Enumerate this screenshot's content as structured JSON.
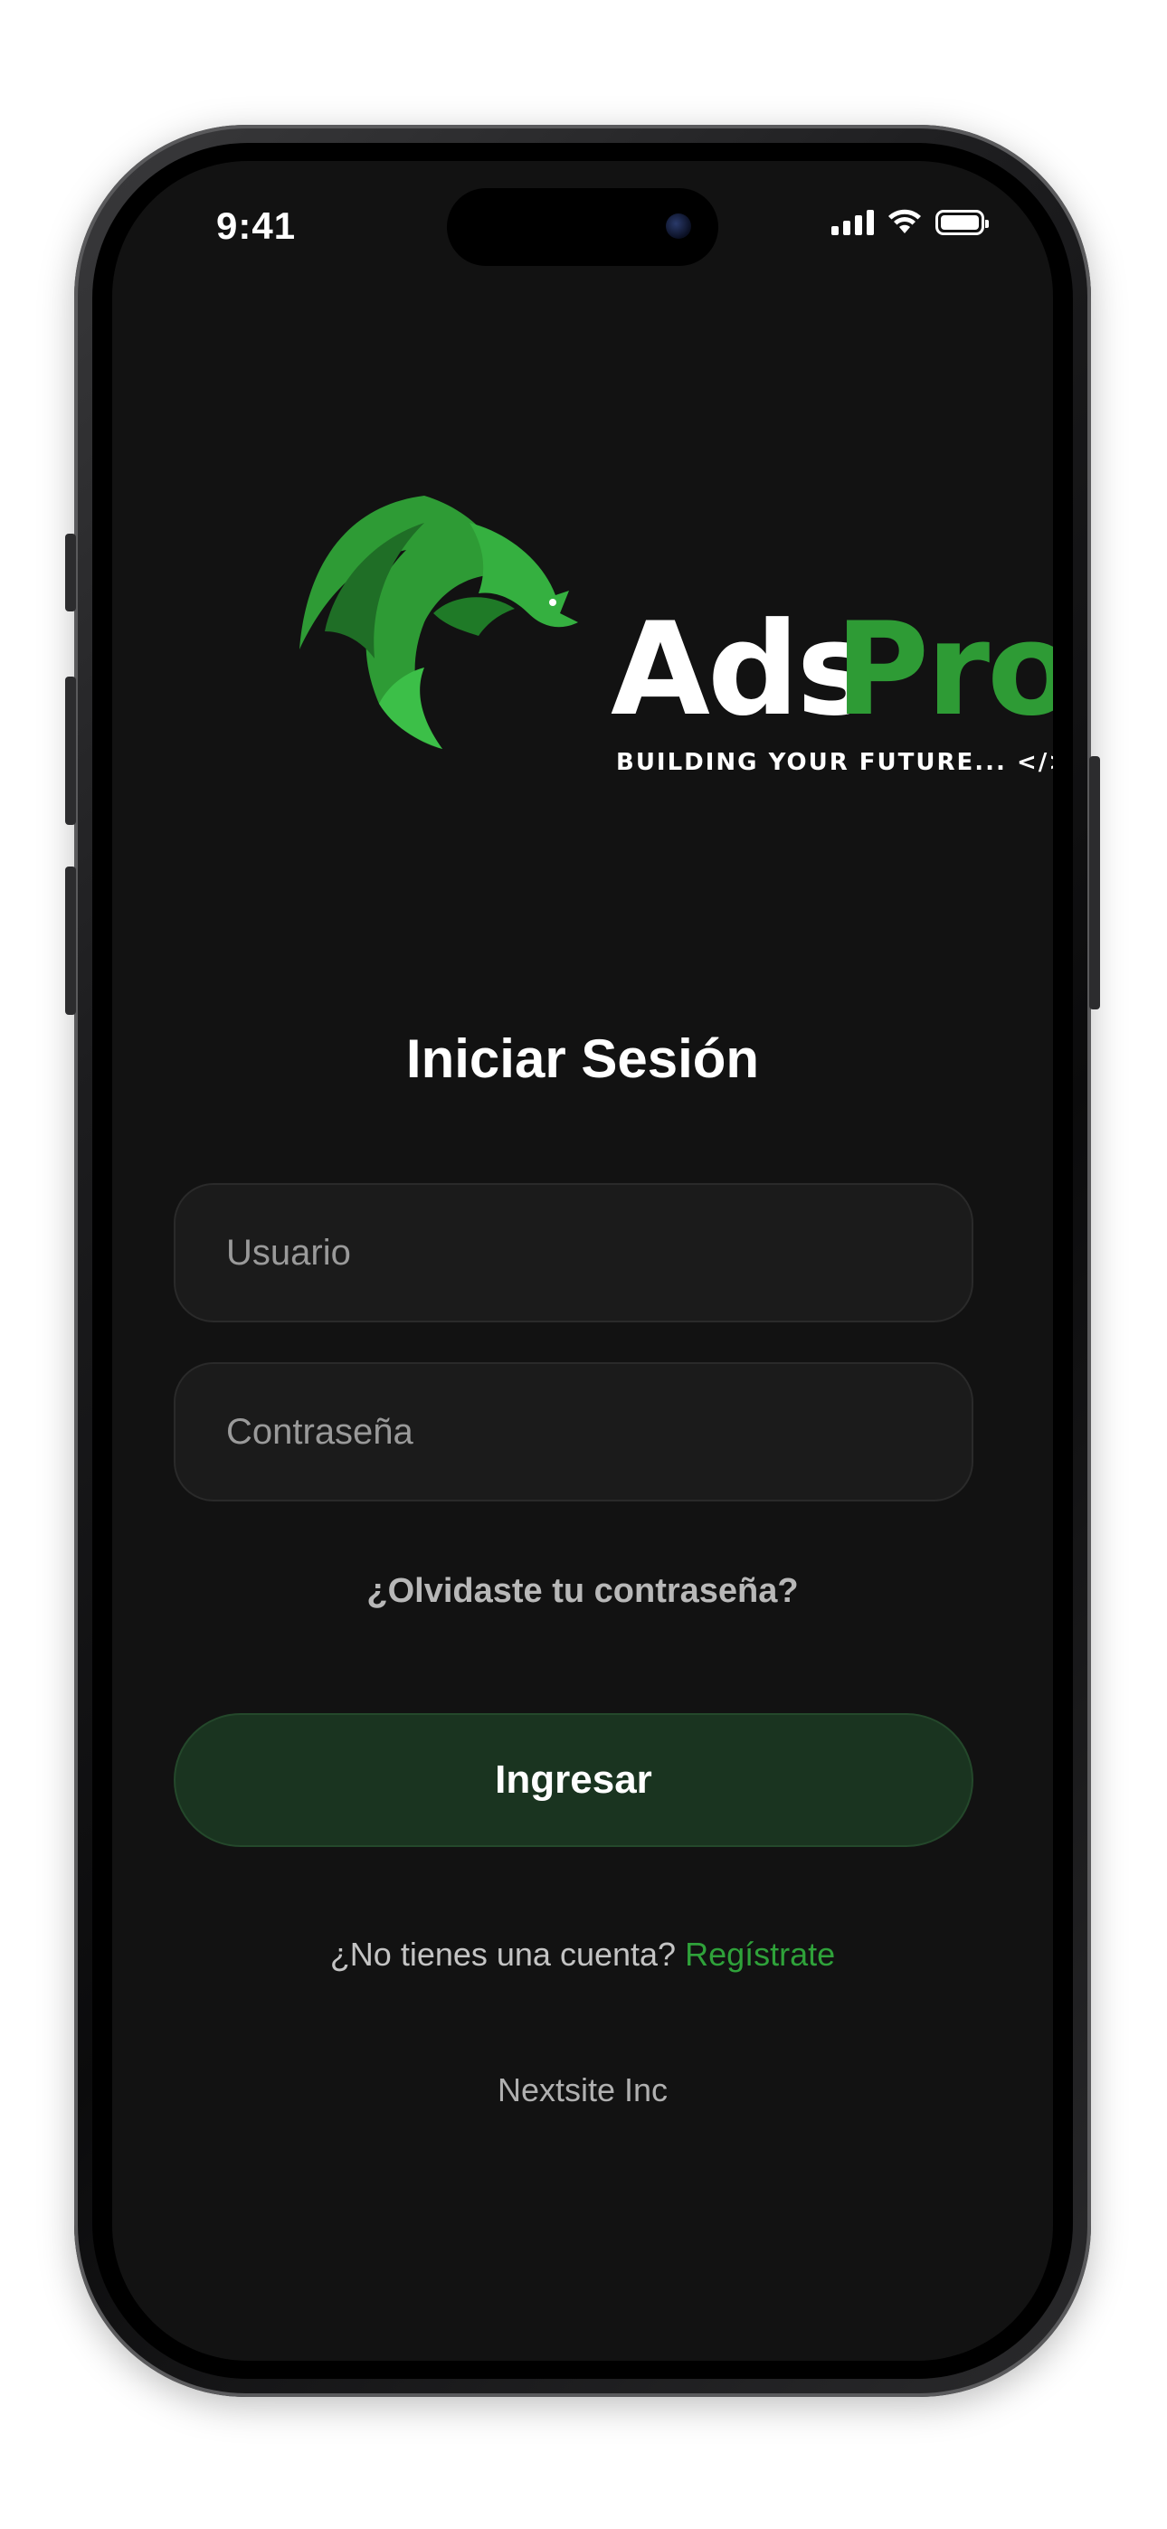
{
  "status_bar": {
    "time": "9:41"
  },
  "logo": {
    "word_part1": "Ads",
    "word_part2": "Pro",
    "tagline": "BUILDING YOUR FUTURE... </>",
    "colors": {
      "white": "#ffffff",
      "green": "#2e9b35"
    }
  },
  "login": {
    "title": "Iniciar Sesión",
    "username_placeholder": "Usuario",
    "password_placeholder": "Contraseña",
    "forgot_label": "¿Olvidaste tu contraseña?",
    "submit_label": "Ingresar",
    "register_prompt": "¿No tienes una cuenta?",
    "register_link": "Regístrate"
  },
  "footer": {
    "company": "Nextsite Inc"
  },
  "theme": {
    "background": "#121212",
    "accent": "#2fa23a",
    "button": "#1a3420"
  }
}
